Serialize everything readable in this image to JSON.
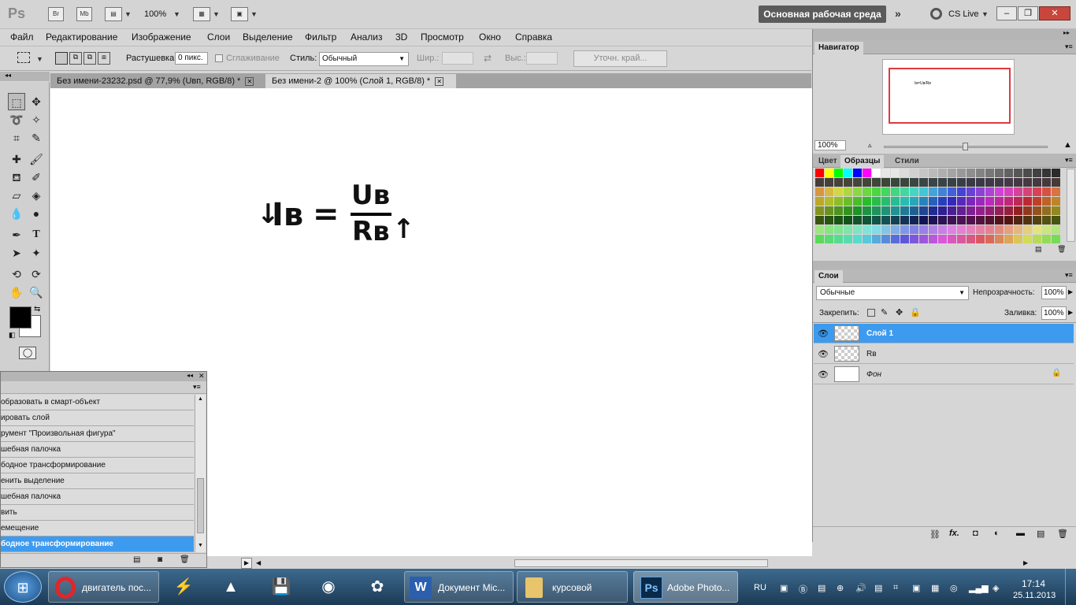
{
  "app": {
    "logo": "Ps",
    "bridge_label": "Br",
    "minibridge_label": "Mb",
    "zoom": "100%",
    "workspace": "Основная рабочая среда",
    "cslive": "CS Live"
  },
  "menu": [
    "Файл",
    "Редактирование",
    "Изображение",
    "Слои",
    "Выделение",
    "Фильтр",
    "Анализ",
    "3D",
    "Просмотр",
    "Окно",
    "Справка"
  ],
  "options": {
    "feather_label": "Растушевка:",
    "feather_value": "0 пикс.",
    "antialias_label": "Сглаживание",
    "style_label": "Стиль:",
    "style_value": "Обычный",
    "width_label": "Шир.:",
    "height_label": "Выс.:",
    "refine_edge": "Уточн. край..."
  },
  "tabs": [
    {
      "label": "Без имени-23232.psd @ 77,9% (Uвп, RGB/8) *"
    },
    {
      "label": "Без имени-2 @ 100% (Слой 1, RGB/8) *"
    }
  ],
  "formula": {
    "down_arrow": "↓",
    "lhs": "Iв",
    "equals": "=",
    "numerator": "Uв",
    "denominator": "Rв",
    "up_arrow": "↑"
  },
  "navigator": {
    "title": "Навигатор",
    "zoom": "100%"
  },
  "swatches_panel": {
    "tabs": [
      "Цвет",
      "Образцы",
      "Стили"
    ],
    "active": "Образцы"
  },
  "layers": {
    "title": "Слои",
    "blend_mode": "Обычные",
    "opacity_label": "Непрозрачность:",
    "opacity_value": "100%",
    "lock_label": "Закрепить:",
    "fill_label": "Заливка:",
    "fill_value": "100%",
    "items": [
      {
        "name": "Слой 1",
        "selected": true
      },
      {
        "name": "Rв",
        "selected": false
      },
      {
        "name": "Фон",
        "selected": false,
        "locked": true
      }
    ]
  },
  "history": {
    "items": [
      "образовать в смарт-объект",
      "ировать слой",
      "румент \"Произвольная фигура\"",
      "шебная палочка",
      "бодное трансформирование",
      "енить выделение",
      "шебная палочка",
      "вить",
      "емещение",
      "бодное трансформирование"
    ],
    "selected_index": 9
  },
  "taskbar": {
    "items": [
      {
        "label": "двигатель пос..."
      },
      {
        "label": "Документ Mic..."
      },
      {
        "label": "курсовой"
      },
      {
        "label": "Adobe Photo..."
      }
    ],
    "lang": "RU",
    "time": "17:14",
    "date": "25.11.2013"
  },
  "colors": {
    "selection_blue": "#3d9bef",
    "foreground": "#000000",
    "background": "#ffffff",
    "navigator_frame": "#e0393e"
  }
}
